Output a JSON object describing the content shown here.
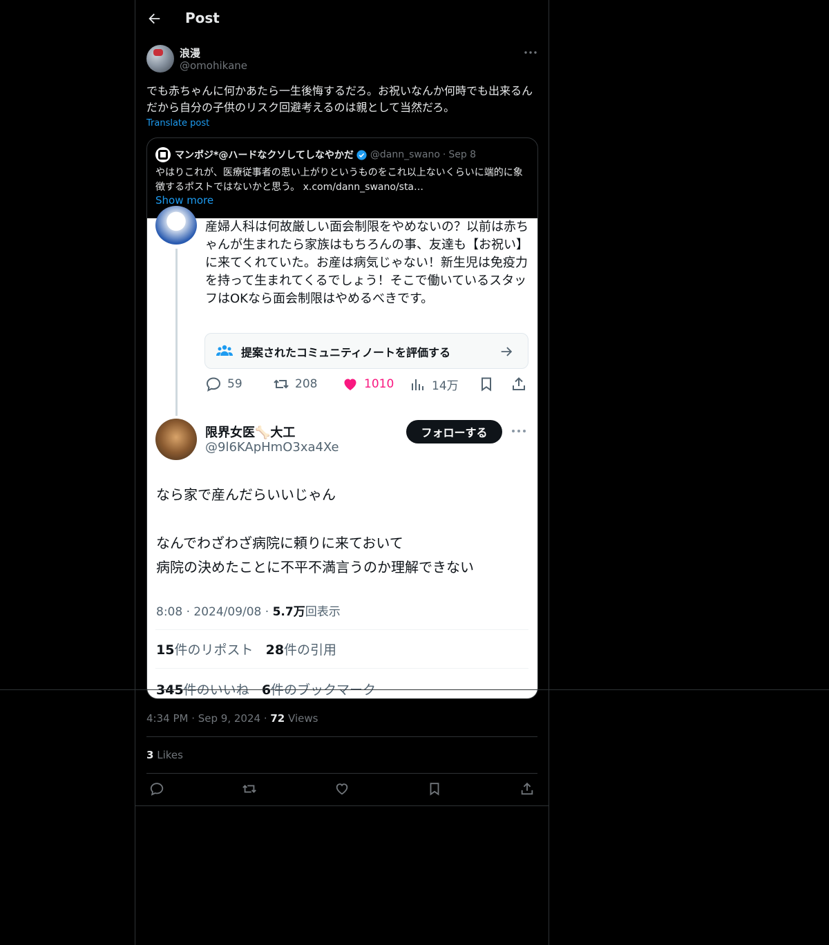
{
  "header": {
    "title": "Post"
  },
  "author": {
    "name": "浪漫",
    "handle": "@omohikane"
  },
  "post": {
    "text": "でも赤ちゃんに何かあたら一生後悔するだろ。お祝いなんか何時でも出来るんだから自分の子供のリスク回避考えるのは親として当然だろ。",
    "translate": "Translate post",
    "time": "4:34 PM",
    "date": "Sep 9, 2024",
    "views_count": "72",
    "views_label": "Views",
    "likes_count": "3",
    "likes_label": "Likes"
  },
  "quote": {
    "name": "マンポジ*@ハードなクソしてしなやかだ",
    "handle": "@dann_swano",
    "date": "Sep 8",
    "text": "やはりこれが、医療従事者の思い上がりというものをこれ以上ないくらいに端的に象徴するポストではないかと思う。 x.com/dann_swano/sta…",
    "show_more": "Show more"
  },
  "embedded": {
    "reply_text": "産婦人科は何故厳しい面会制限をやめないの？以前は赤ちゃんが生まれたら家族はもちろんの事、友達も【お祝い】に来てくれていた。お産は病気じゃない！新生児は免疫力を持って生まれてくるでしょう！そこで働いているスタッフはOKなら面会制限はやめるべきです。",
    "community_note": "提案されたコミュニティノートを評価する",
    "replies": "59",
    "reposts": "208",
    "likes": "1010",
    "views": "14万",
    "second_name": "限界女医🦴大工",
    "second_handle": "@9l6KApHmO3xa4Xe",
    "follow": "フォローする",
    "second_text_1": "なら家で産んだらいいじゃん",
    "second_text_2": "なんでわざわざ病院に頼りに来ておいて",
    "second_text_3": "病院の決めたことに不平不満言うのか理解できない",
    "meta_time": "8:08 · 2024/09/08 · ",
    "meta_views": "5.7万",
    "meta_views_label": "回表示",
    "reposts_count": "15",
    "reposts_label": "件のリポスト",
    "quotes_count": "28",
    "quotes_label": "件の引用",
    "likes_count": "345",
    "likes_label": "件のいいね",
    "bookmarks_count": "6",
    "bookmarks_label": "件のブックマーク"
  },
  "colors": {
    "accent": "#1d9bf0",
    "like": "#f91880",
    "background": "#000000",
    "text": "#e7e9ea",
    "muted": "#71767b"
  }
}
